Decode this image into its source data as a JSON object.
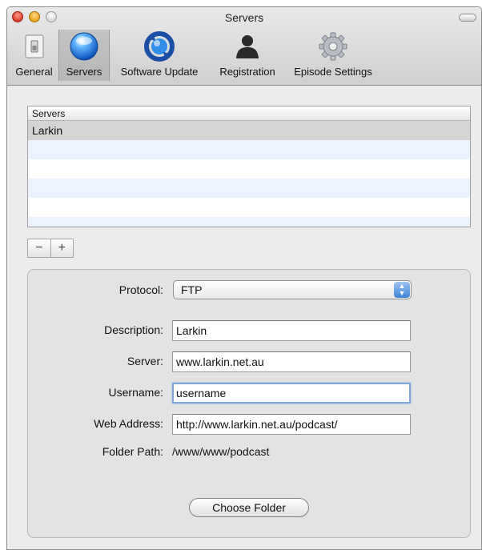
{
  "window": {
    "title": "Servers"
  },
  "toolbar": {
    "items": [
      {
        "label": "General",
        "icon": "general-switch-icon"
      },
      {
        "label": "Servers",
        "icon": "servers-globe-icon",
        "selected": true
      },
      {
        "label": "Software Update",
        "icon": "software-update-icon"
      },
      {
        "label": "Registration",
        "icon": "registration-person-icon"
      },
      {
        "label": "Episode Settings",
        "icon": "episode-settings-gear-icon"
      }
    ]
  },
  "servers_list": {
    "header": "Servers",
    "rows": [
      "Larkin",
      "",
      "",
      "",
      "",
      ""
    ],
    "selected_index": 0
  },
  "list_buttons": {
    "remove": "−",
    "add": "+"
  },
  "form": {
    "protocol": {
      "label": "Protocol:",
      "value": "FTP"
    },
    "description": {
      "label": "Description:",
      "value": "Larkin"
    },
    "server": {
      "label": "Server:",
      "value": "www.larkin.net.au"
    },
    "username": {
      "label": "Username:",
      "value": "username"
    },
    "web_address": {
      "label": "Web Address:",
      "value": "http://www.larkin.net.au/podcast/"
    },
    "folder_path": {
      "label": "Folder Path:",
      "value": "/www/www/podcast"
    },
    "choose_folder": "Choose Folder"
  },
  "colors": {
    "selection_blue": "#7fa7dc",
    "row_alt": "#edf3fe",
    "window_bg": "#ececec"
  }
}
